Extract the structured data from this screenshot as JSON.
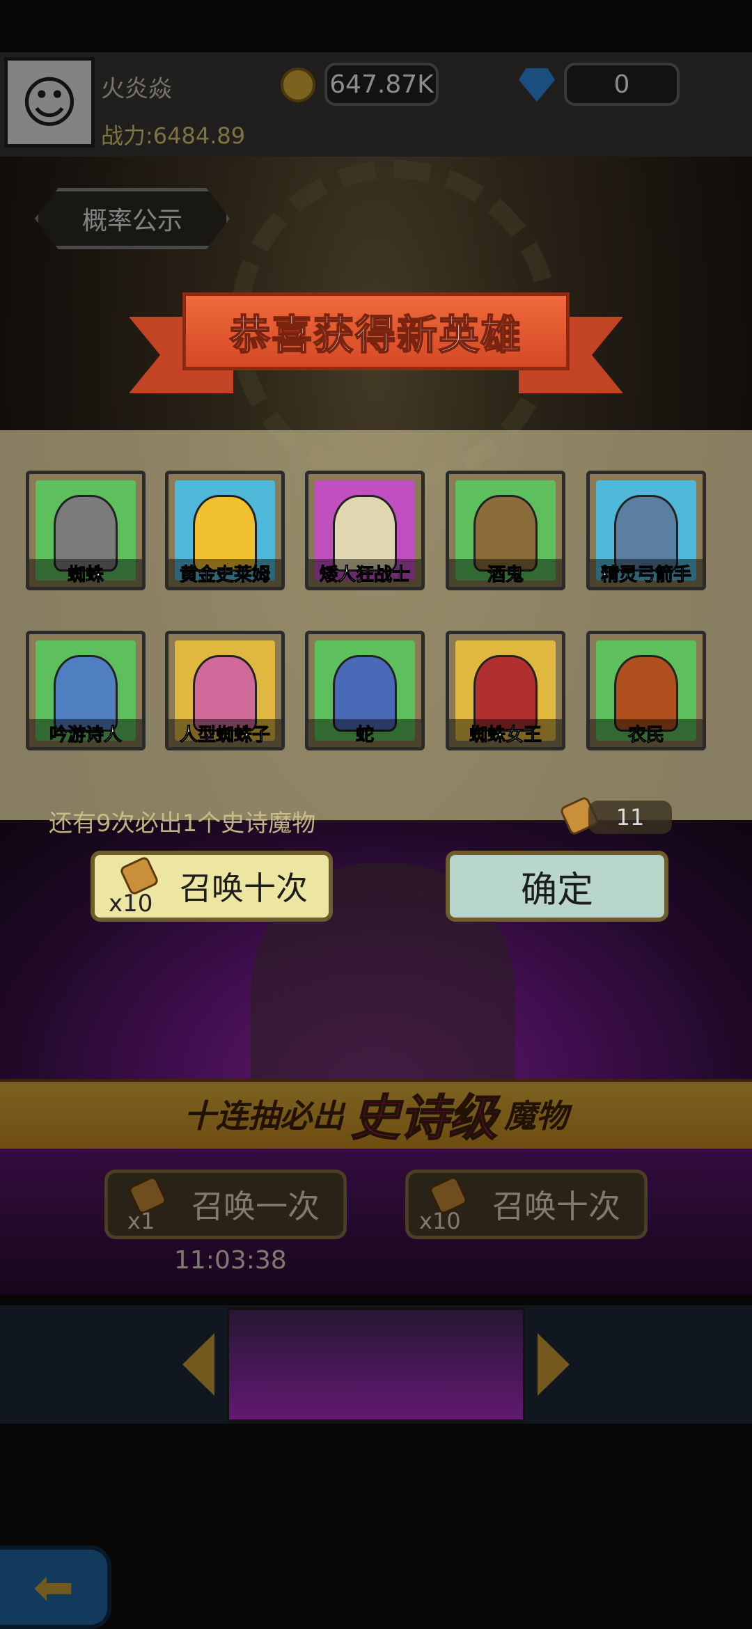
{
  "player": {
    "name": "火炎焱",
    "power_label": "战力:6484.89",
    "gold": "647.87K",
    "gems": "0"
  },
  "probability_button": "概率公示",
  "congrats_title": "恭喜获得新英雄",
  "heroes": [
    {
      "name": "蜘蛛",
      "bg": "#5dc05d",
      "fig": "#7b7b7b"
    },
    {
      "name": "黄金史莱姆",
      "bg": "#4fb8d8",
      "fig": "#f0c030"
    },
    {
      "name": "矮人狂战士",
      "bg": "#c04fc0",
      "fig": "#e0d7b0"
    },
    {
      "name": "酒鬼",
      "bg": "#5dc05d",
      "fig": "#8a6d3a"
    },
    {
      "name": "精灵弓箭手",
      "bg": "#4fb8d8",
      "fig": "#5a7fa0"
    },
    {
      "name": "吟游诗人",
      "bg": "#5dc05d",
      "fig": "#4f7fc0"
    },
    {
      "name": "人型蜘蛛子",
      "bg": "#e0b840",
      "fig": "#d06a9a"
    },
    {
      "name": "蛇",
      "bg": "#5dc05d",
      "fig": "#4a6ab8"
    },
    {
      "name": "蜘蛛女王",
      "bg": "#e0b840",
      "fig": "#b03030"
    },
    {
      "name": "农民",
      "bg": "#5dc05d",
      "fig": "#b0501e"
    }
  ],
  "pity_notice": "还有9次必出1个史诗魔物",
  "scroll_count": "11",
  "summon_ten_label": "召唤十次",
  "summon_ten_mult": "x10",
  "confirm_label": "确定",
  "epic_banner": {
    "prefix": "十连抽必出",
    "highlight": "史诗级",
    "suffix": "魔物"
  },
  "summon_once_label": "召唤一次",
  "summon_once_mult": "x1",
  "summon_ten_bottom_label": "召唤十次",
  "summon_ten_bottom_mult": "x10",
  "timer": "11:03:38"
}
